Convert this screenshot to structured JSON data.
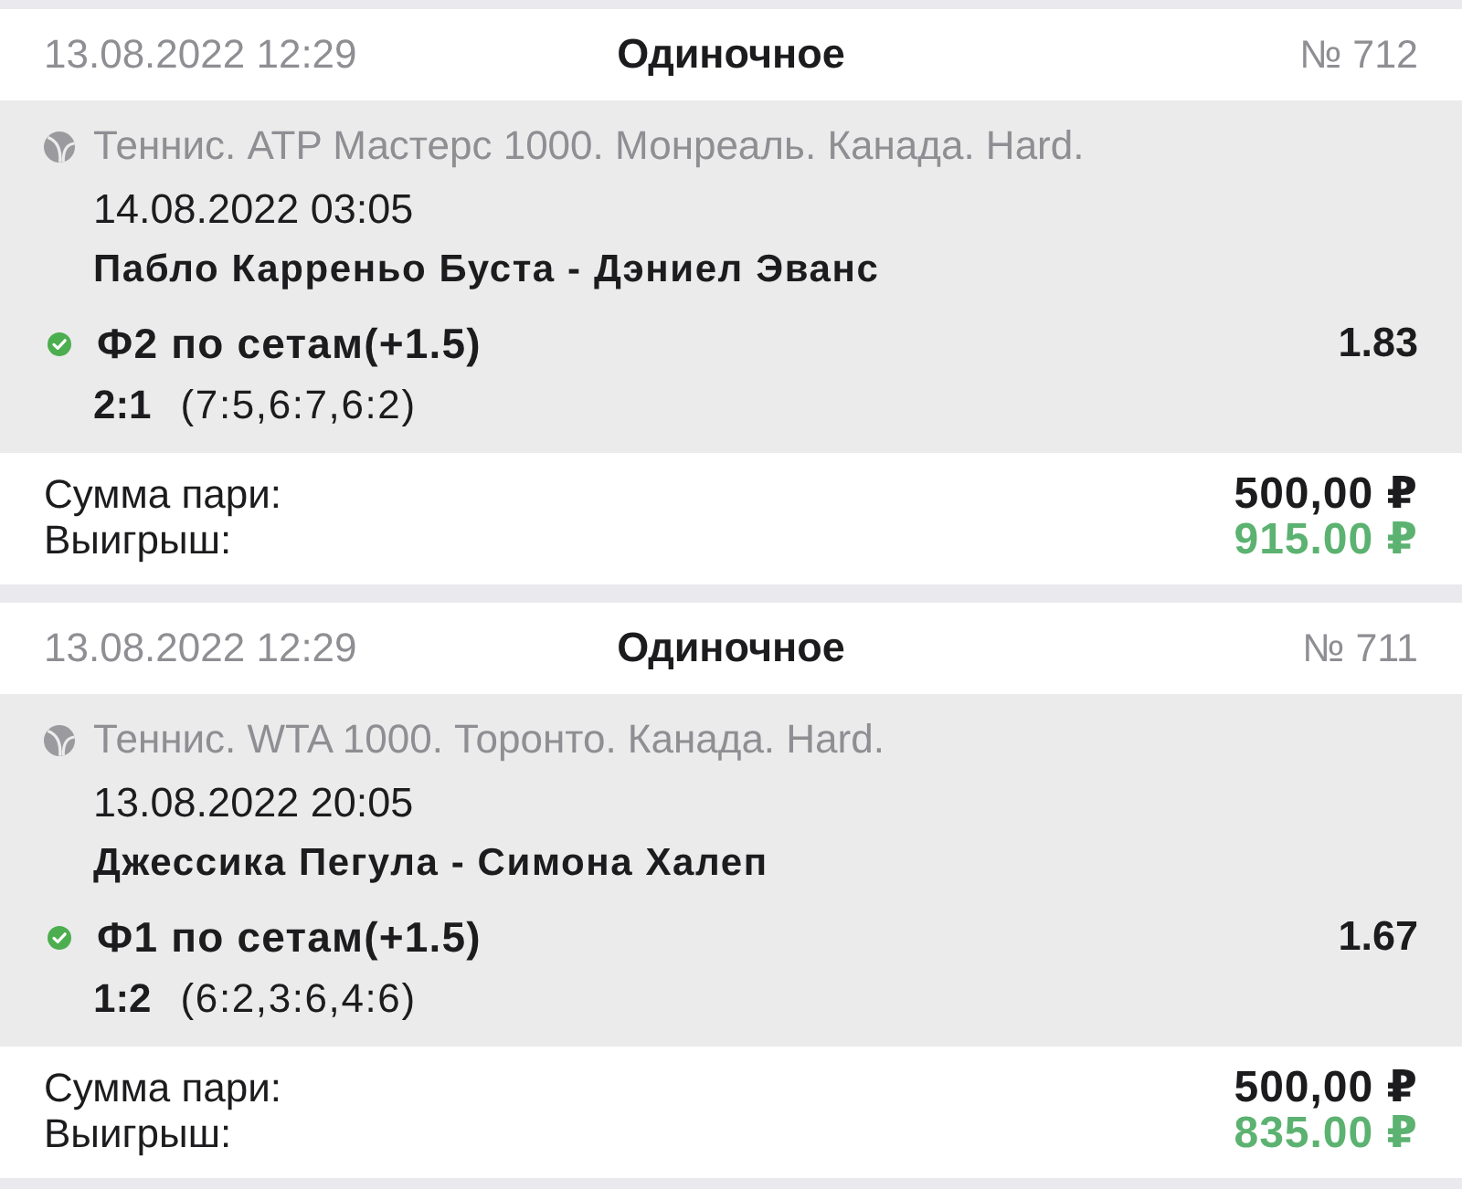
{
  "bets": [
    {
      "placed": "13.08.2022 12:29",
      "type": "Одиночное",
      "number": "№ 712",
      "event": {
        "league": "Теннис. ATP Мастерс 1000. Монреаль. Канада. Hard.",
        "start": "14.08.2022 03:05",
        "match": "Пабло Карреньо Буста - Дэниел Эванс",
        "outcome": {
          "won": true,
          "market": "Ф2 по сетам(+1.5)",
          "odds": "1.83",
          "score": "2:1",
          "sets": "(7:5,6:7,6:2)"
        }
      },
      "stake_label": "Сумма пари:",
      "stake": "500,00 ₽",
      "payout_label": "Выигрыш:",
      "payout": "915.00 ₽"
    },
    {
      "placed": "13.08.2022 12:29",
      "type": "Одиночное",
      "number": "№ 711",
      "event": {
        "league": "Теннис. WTA 1000. Торонто. Канада. Hard.",
        "start": "13.08.2022 20:05",
        "match": "Джессика Пегула - Симона Халеп",
        "outcome": {
          "won": true,
          "market": "Ф1 по сетам(+1.5)",
          "odds": "1.67",
          "score": "1:2",
          "sets": "(6:2,3:6,4:6)"
        }
      },
      "stake_label": "Сумма пари:",
      "stake": "500,00 ₽",
      "payout_label": "Выигрыш:",
      "payout": "835.00 ₽"
    }
  ]
}
